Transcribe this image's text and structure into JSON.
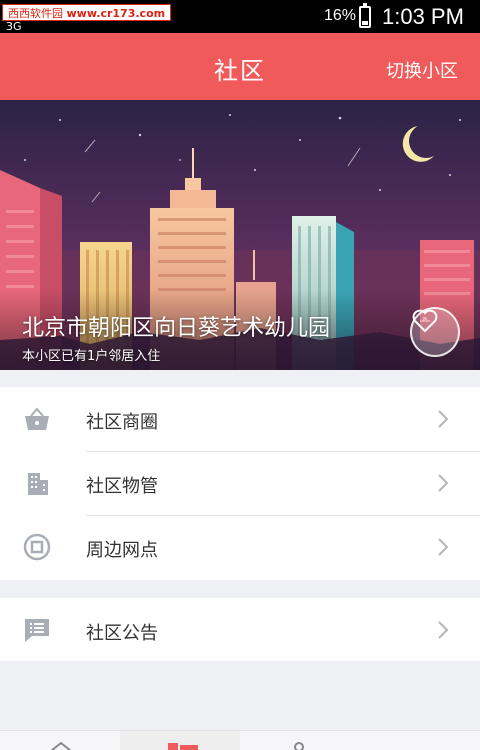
{
  "status_bar": {
    "watermark_site": "西西软件园",
    "watermark_url": "www.cr173.com",
    "network": "3G",
    "battery": "16%",
    "time": "1:03 PM"
  },
  "header": {
    "title": "社区",
    "action": "切换小区"
  },
  "banner": {
    "community_name": "北京市朝阳区向日葵艺术幼儿园",
    "subtitle": "本小区已有1户邻居入住"
  },
  "menu": [
    {
      "label": "社区商圈",
      "icon": "basket-icon"
    },
    {
      "label": "社区物管",
      "icon": "building-icon"
    },
    {
      "label": "周边网点",
      "icon": "bank-coin-icon"
    }
  ],
  "menu2": [
    {
      "label": "社区公告",
      "icon": "announcement-icon"
    }
  ],
  "colors": {
    "accent": "#f05a5a",
    "icon_gray": "#a9adb6",
    "background": "#eef0f4"
  }
}
